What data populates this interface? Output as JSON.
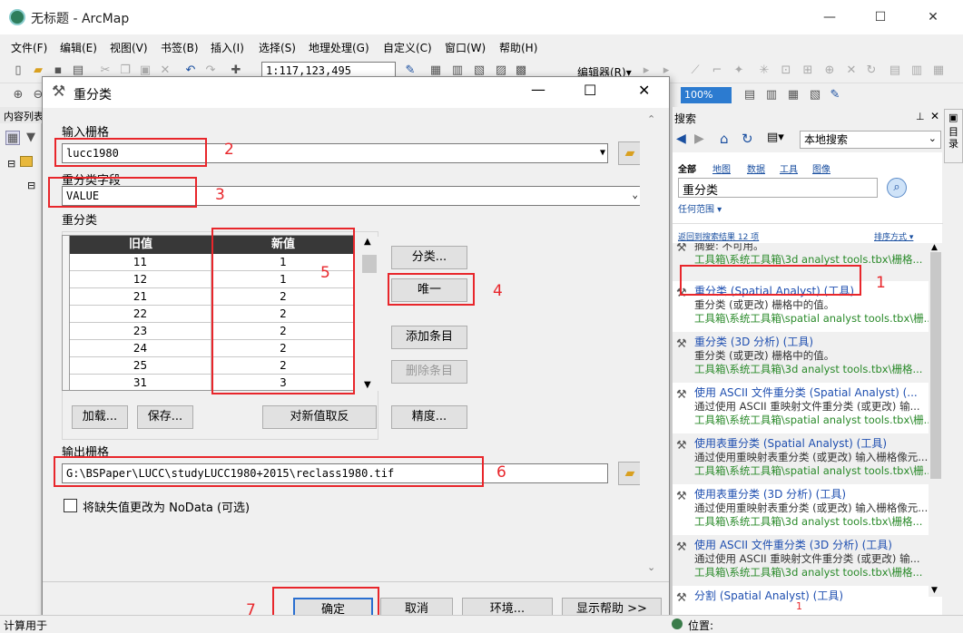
{
  "app": {
    "title": "无标题 - ArcMap",
    "minimize": "—",
    "maximize": "☐",
    "close": "✕"
  },
  "menu": [
    "文件(F)",
    "编辑(E)",
    "视图(V)",
    "书签(B)",
    "插入(I)",
    "选择(S)",
    "地理处理(G)",
    "自定义(C)",
    "窗口(W)",
    "帮助(H)"
  ],
  "toolbar": {
    "scale": "1:117,123,495",
    "editor": "编辑器(R)▾",
    "zoom": "100%"
  },
  "toc": {
    "title": "内容列表"
  },
  "dialog": {
    "title": "重分类",
    "input_raster_label": "输入栅格",
    "input_raster_value": "lucc1980",
    "reclass_field_label": "重分类字段",
    "reclass_field_value": "VALUE",
    "reclass_label": "重分类",
    "col_old": "旧值",
    "col_new": "新值",
    "rows": [
      [
        "11",
        "1"
      ],
      [
        "12",
        "1"
      ],
      [
        "21",
        "2"
      ],
      [
        "22",
        "2"
      ],
      [
        "23",
        "2"
      ],
      [
        "24",
        "2"
      ],
      [
        "25",
        "2"
      ],
      [
        "31",
        "3"
      ]
    ],
    "classify_btn": "分类...",
    "unique_btn": "唯一",
    "add_entry_btn": "添加条目",
    "delete_entry_btn": "删除条目",
    "load_btn": "加载...",
    "save_btn": "保存...",
    "reverse_btn": "对新值取反",
    "precision_btn": "精度...",
    "output_label": "输出栅格",
    "output_value": "G:\\BSPaper\\LUCC\\studyLUCC1980+2015\\reclass1980.tif",
    "nodata_label": "将缺失值更改为 NoData (可选)",
    "ok_btn": "确定",
    "cancel_btn": "取消",
    "env_btn": "环境...",
    "help_btn": "显示帮助 >>"
  },
  "annotations": [
    "1",
    "2",
    "3",
    "4",
    "5",
    "6",
    "7"
  ],
  "search": {
    "title": "搜索",
    "scope": "本地搜索",
    "tabs": [
      "全部",
      "地图",
      "数据",
      "工具",
      "图像"
    ],
    "query": "重分类",
    "range": "任何范围 ▾",
    "back": "返回到搜索结果 12 项",
    "sort": "排序方式 ▾",
    "results": [
      {
        "title": "",
        "desc": "摘要: 不可用。",
        "path": "工具箱\\系统工具箱\\3d analyst tools.tbx\\栅格..."
      },
      {
        "title": "重分类 (Spatial Analyst) (工具)",
        "desc": "重分类 (或更改) 栅格中的值。",
        "path": "工具箱\\系统工具箱\\spatial analyst tools.tbx\\栅..."
      },
      {
        "title": "重分类 (3D 分析) (工具)",
        "desc": "重分类 (或更改) 栅格中的值。",
        "path": "工具箱\\系统工具箱\\3d analyst tools.tbx\\栅格..."
      },
      {
        "title": "使用 ASCII 文件重分类 (Spatial Analyst) (...",
        "desc": "通过使用 ASCII 重映射文件重分类 (或更改) 输...",
        "path": "工具箱\\系统工具箱\\spatial analyst tools.tbx\\栅..."
      },
      {
        "title": "使用表重分类 (Spatial Analyst) (工具)",
        "desc": "通过使用重映射表重分类 (或更改) 输入栅格像元...",
        "path": "工具箱\\系统工具箱\\spatial analyst tools.tbx\\栅..."
      },
      {
        "title": "使用表重分类 (3D 分析) (工具)",
        "desc": "通过使用重映射表重分类 (或更改) 输入栅格像元...",
        "path": "工具箱\\系统工具箱\\3d analyst tools.tbx\\栅格..."
      },
      {
        "title": "使用 ASCII 文件重分类 (3D 分析) (工具)",
        "desc": "通过使用 ASCII 重映射文件重分类 (或更改) 输...",
        "path": "工具箱\\系统工具箱\\3d analyst tools.tbx\\栅格..."
      },
      {
        "title": "分割 (Spatial Analyst) (工具)",
        "desc": "",
        "path": ""
      }
    ],
    "catalog_tab": "目录"
  },
  "status": {
    "left": "计算用于",
    "position": "位置:"
  }
}
